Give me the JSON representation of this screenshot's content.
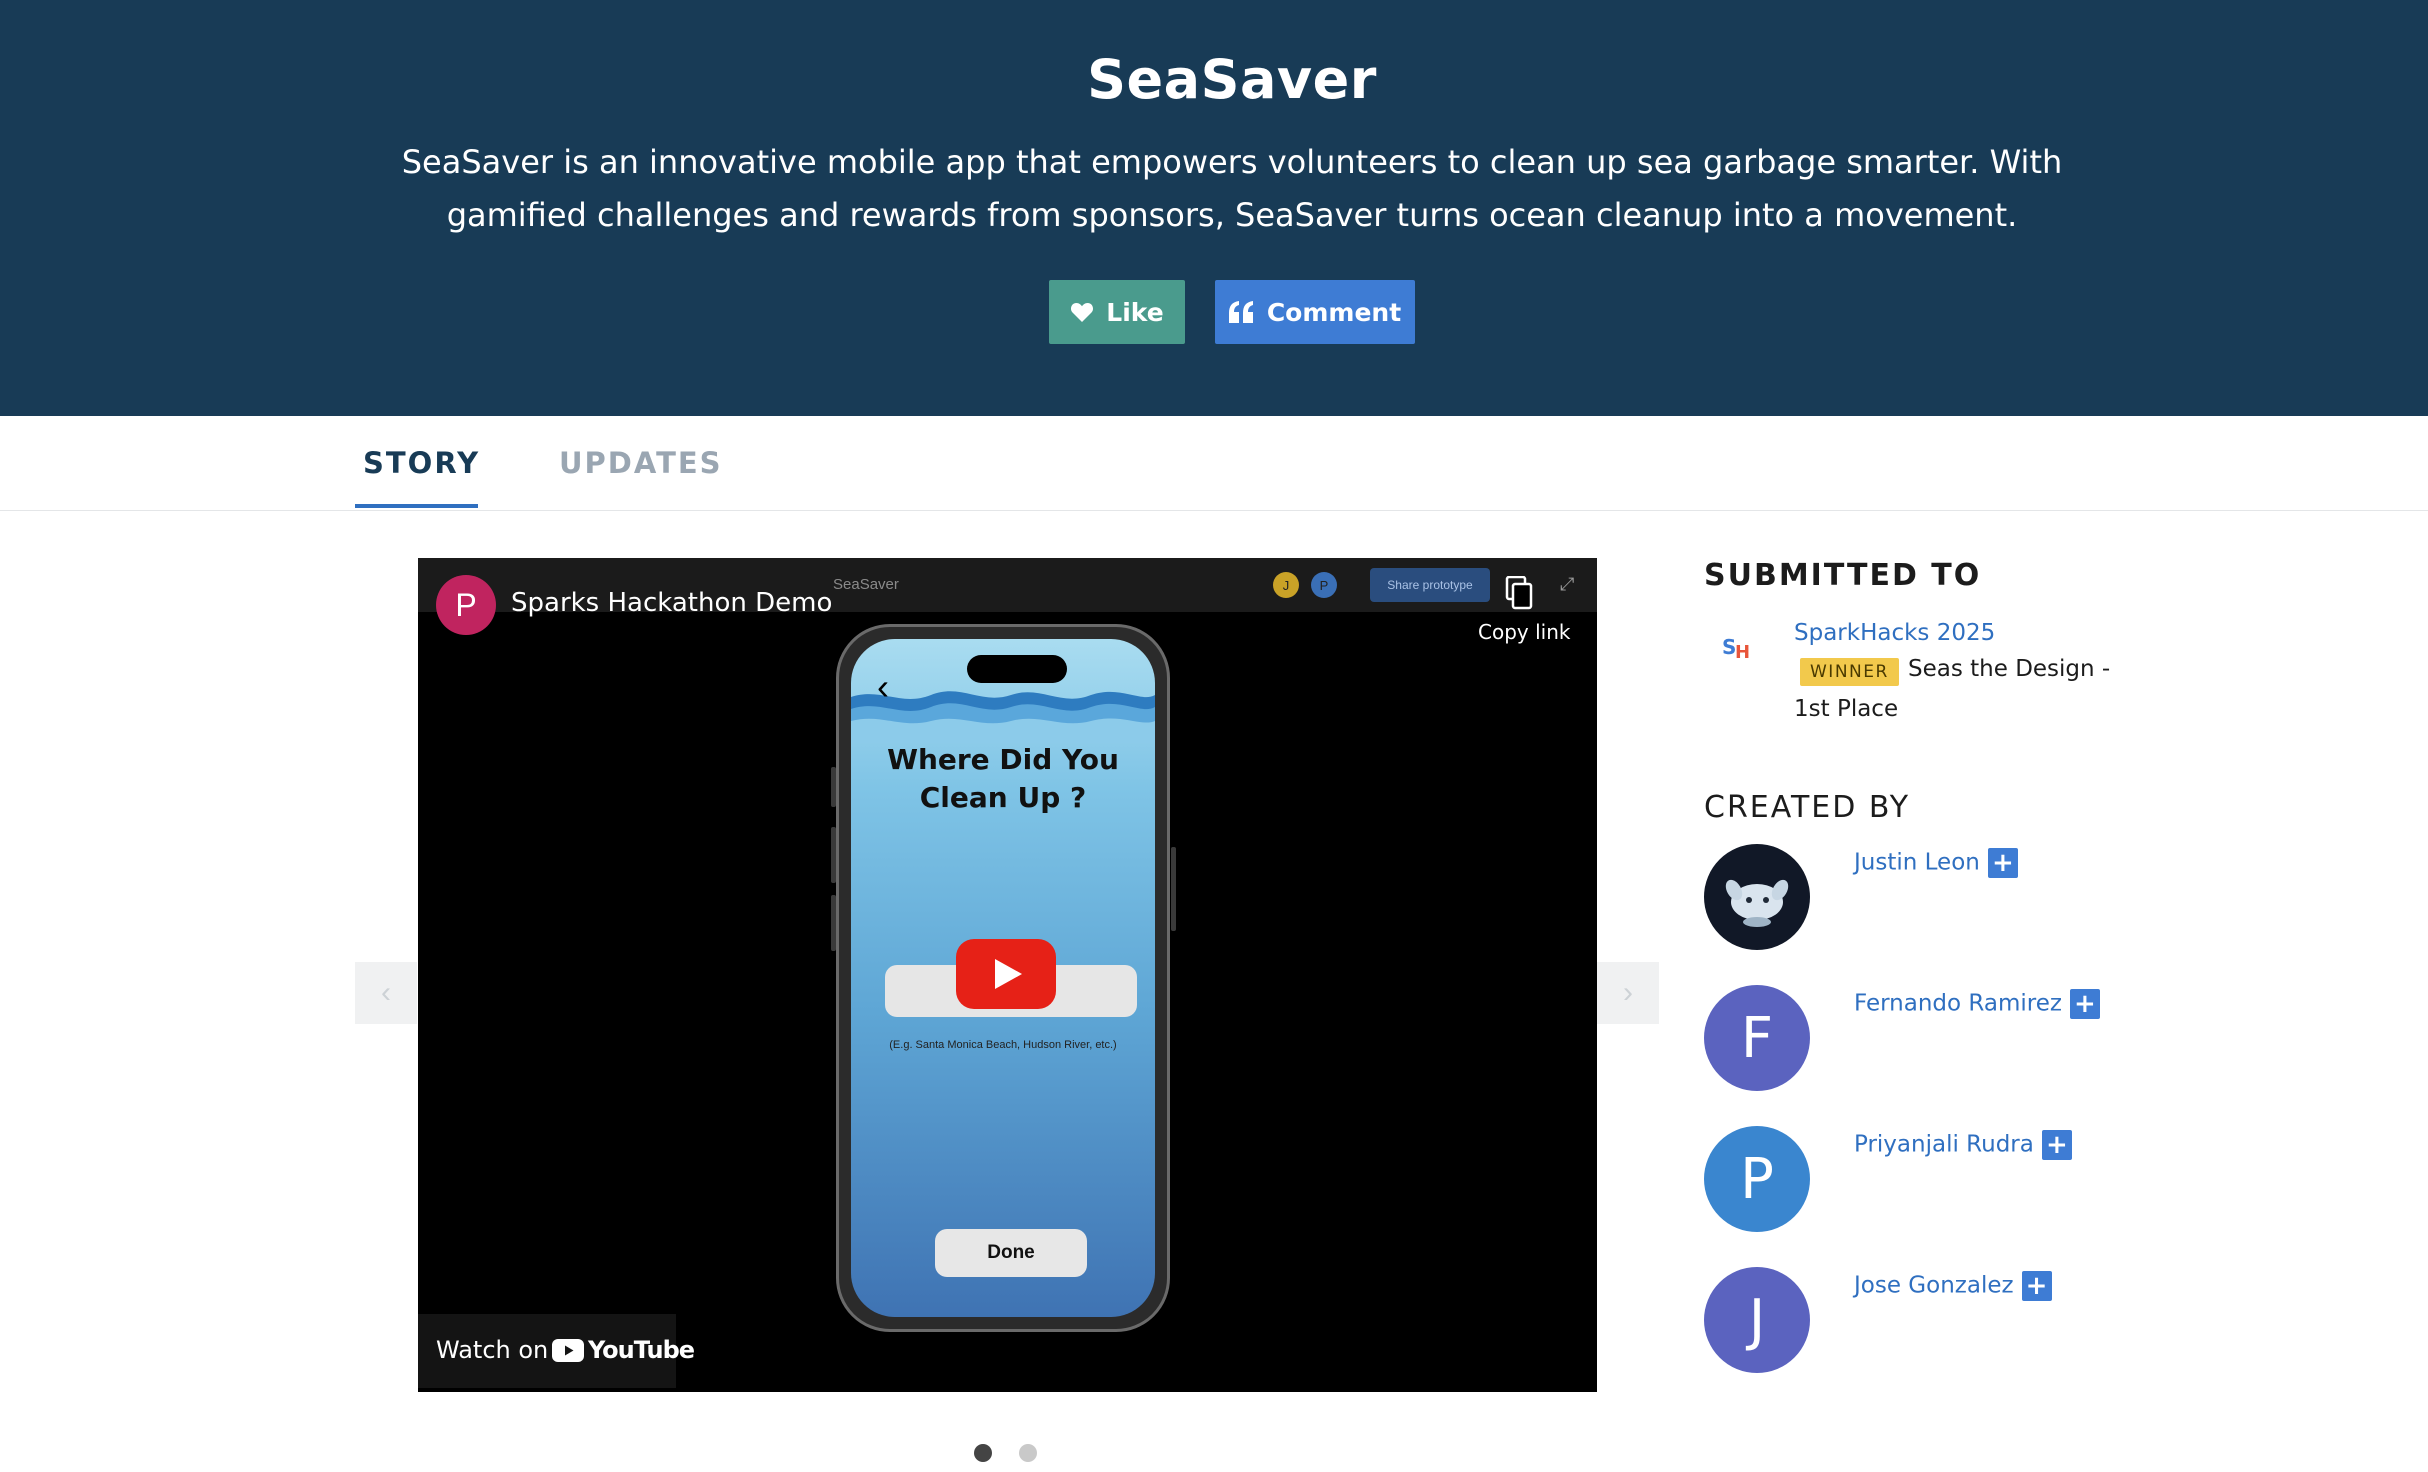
{
  "project": {
    "title": "SeaSaver",
    "tagline": "SeaSaver is an innovative mobile app that empowers volunteers to clean up sea garbage smarter. With gamified challenges and rewards from sponsors, SeaSaver turns ocean cleanup into a movement."
  },
  "actions": {
    "like_label": "Like",
    "comment_label": "Comment",
    "like_color": "#4a9b8d",
    "comment_color": "#3e7cd4"
  },
  "tabs": [
    {
      "label": "STORY",
      "active": true
    },
    {
      "label": "UPDATES",
      "active": false
    }
  ],
  "video": {
    "channel_initial": "P",
    "title": "Sparks Hackathon Demo",
    "copy_link": "Copy link",
    "watch_on": "Watch on",
    "youtube_word": "YouTube",
    "prototype_name": "SeaSaver",
    "prototype_share": "Share prototype",
    "prototype_users": [
      "J",
      "P"
    ],
    "phone": {
      "heading": "Where Did You Clean Up ?",
      "hint": "(E.g. Santa Monica Beach, Hudson River, etc.)",
      "done": "Done"
    }
  },
  "carousel": {
    "dots": 2,
    "active_index": 0
  },
  "sidebar": {
    "submitted_heading": "SUBMITTED TO",
    "hackathon": "SparkHacks 2025",
    "badge": "WINNER",
    "prize_line1": "Seas the Design -",
    "prize_line2": "1st Place",
    "created_heading": "CREATED BY",
    "members": [
      {
        "name": "Justin Leon",
        "initial": "",
        "color": "#111827"
      },
      {
        "name": "Fernando Ramirez",
        "initial": "F",
        "color": "#5b63bf"
      },
      {
        "name": "Priyanjali Rudra",
        "initial": "P",
        "color": "#3a86cf"
      },
      {
        "name": "Jose Gonzalez",
        "initial": "J",
        "color": "#5b63bf"
      }
    ],
    "plus_symbol": "+"
  },
  "icons": {
    "like": "heart-icon",
    "comment": "quote-icon",
    "copy": "copy-icon",
    "play": "play-icon",
    "prev": "chevron-left-icon",
    "next": "chevron-right-icon"
  }
}
